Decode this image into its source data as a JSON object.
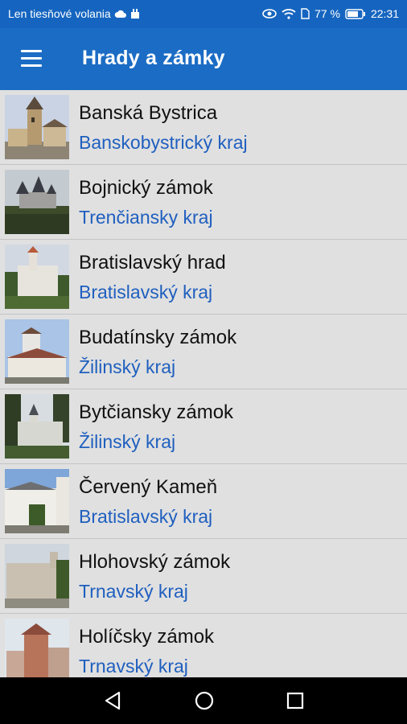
{
  "status_bar": {
    "carrier": "Len tiesňové volania",
    "battery": "77 %",
    "time": "22:31"
  },
  "app_bar": {
    "title": "Hrady a zámky",
    "menu_icon": "hamburger-menu-icon"
  },
  "items": [
    {
      "name": "Banská Bystrica",
      "region": "Banskobystrický kraj"
    },
    {
      "name": "Bojnický zámok",
      "region": "Trenčiansky kraj"
    },
    {
      "name": "Bratislavský hrad",
      "region": "Bratislavský kraj"
    },
    {
      "name": "Budatínsky zámok",
      "region": "Žilinský kraj"
    },
    {
      "name": "Bytčiansky zámok",
      "region": "Žilinský kraj"
    },
    {
      "name": "Červený Kameň",
      "region": "Bratislavský kraj"
    },
    {
      "name": "Hlohovský zámok",
      "region": "Trnavský kraj"
    },
    {
      "name": "Holíčsky zámok",
      "region": "Trnavský kraj"
    }
  ],
  "colors": {
    "app_bar": "#1b6cc4",
    "status_bar": "#1565c0",
    "list_background": "#e0e0e0",
    "region_text": "#1f5fbf"
  },
  "nav_bar": {
    "icons": [
      "back-icon",
      "home-icon",
      "recents-icon"
    ]
  }
}
